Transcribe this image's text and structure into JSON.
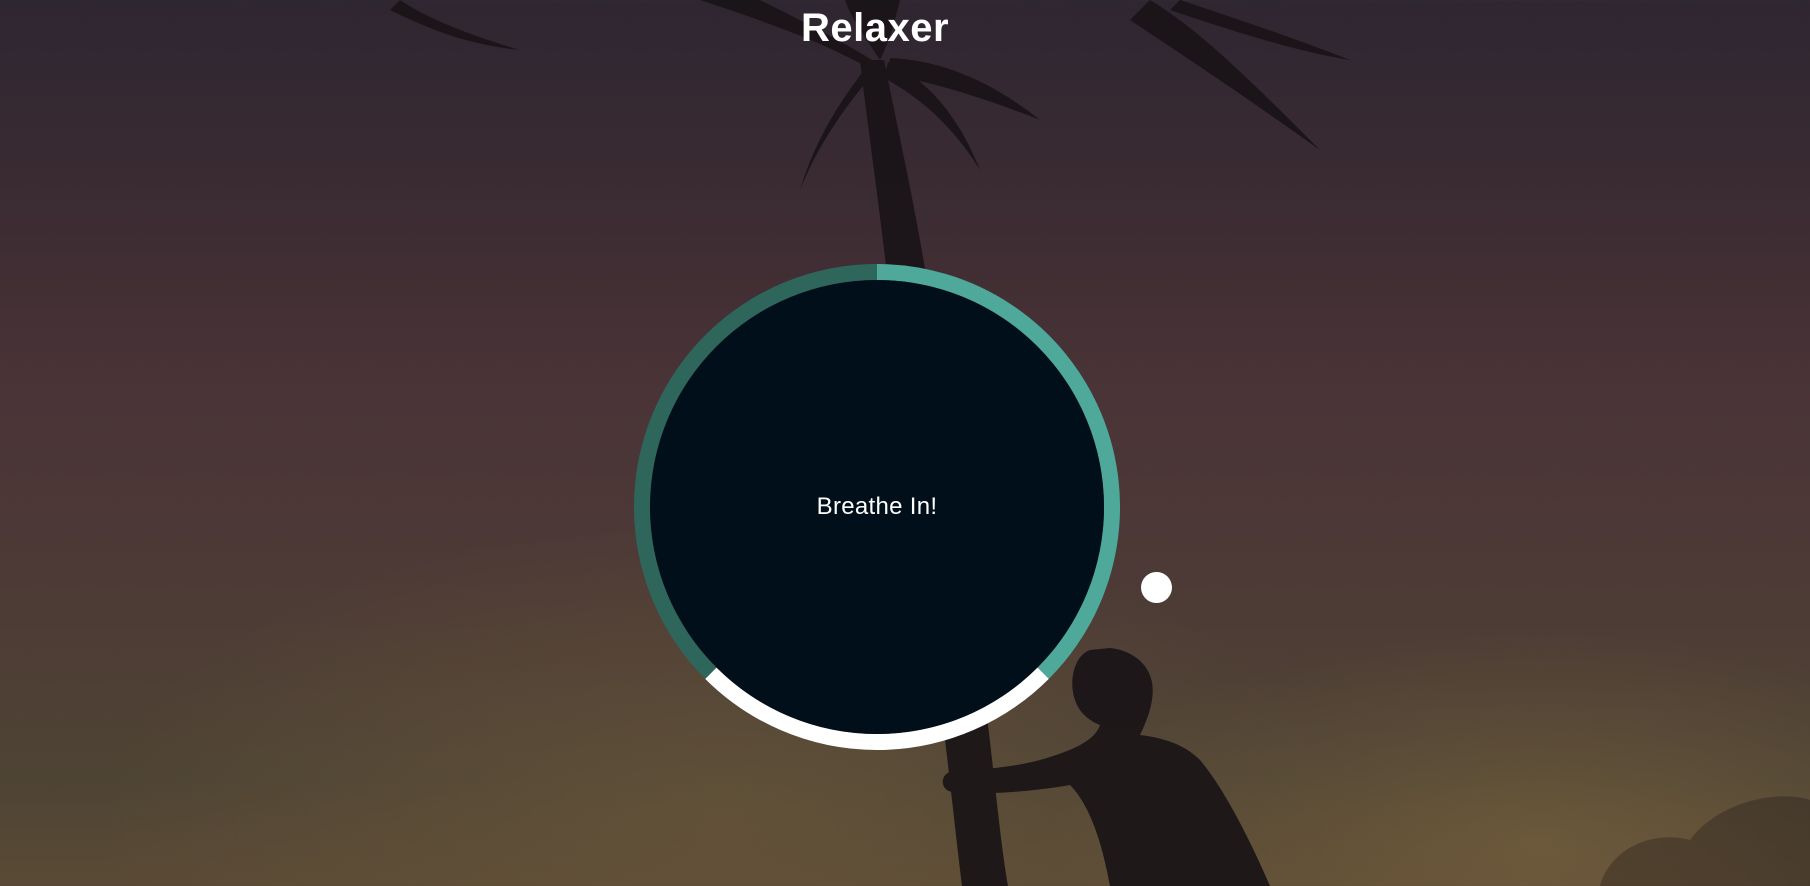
{
  "app": {
    "title": "Relaxer"
  },
  "breathing": {
    "instruction": "Breathe In!",
    "phases": [
      {
        "name": "breathe-in",
        "fraction": 0.375,
        "color": "#4ea99a"
      },
      {
        "name": "hold",
        "fraction": 0.25,
        "color": "#ffffff"
      },
      {
        "name": "breathe-out",
        "fraction": 0.375,
        "color": "#2f665c"
      }
    ],
    "circle_color": "#010f1b",
    "pointer_color": "#ffffff"
  },
  "background": {
    "scene": "palm-tree-silhouette-sunset"
  }
}
